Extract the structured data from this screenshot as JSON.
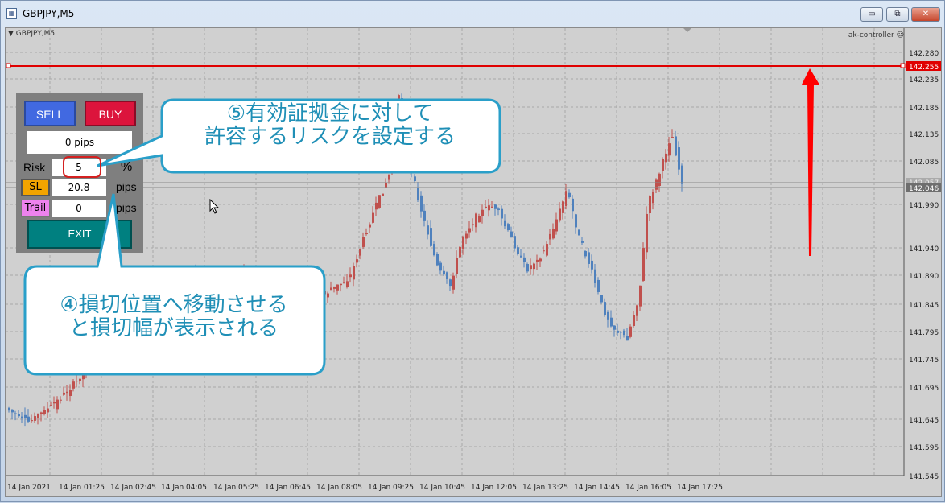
{
  "window": {
    "title": "GBPJPY,M5",
    "minimize_glyph": "▭",
    "restore_glyph": "⧉",
    "close_glyph": "✕"
  },
  "chart": {
    "symbol_label": "▼ GBPJPY,M5",
    "indicator_label": "ak-controller ☺",
    "colors": {
      "up": "#c0504d",
      "down": "#4f81bd",
      "grid": "#a8a8a8",
      "background": "#d0d0d0",
      "line": "#e00000"
    },
    "price_scale": [
      "142.280",
      "142.235",
      "142.185",
      "142.135",
      "142.085",
      "141.990",
      "141.940",
      "141.890",
      "141.845",
      "141.795",
      "141.745",
      "141.695",
      "141.645",
      "141.595",
      "141.545"
    ],
    "current_price": "142.046",
    "current_price_overlapped": "142.057",
    "line_price": "142.255",
    "time_labels": [
      "14 Jan 2021",
      "14 Jan 01:25",
      "14 Jan 02:45",
      "14 Jan 04:05",
      "14 Jan 05:25",
      "14 Jan 06:45",
      "14 Jan 08:05",
      "14 Jan 09:25",
      "14 Jan 10:45",
      "14 Jan 12:05",
      "14 Jan 13:25",
      "14 Jan 14:45",
      "14 Jan 16:05",
      "14 Jan 17:25"
    ]
  },
  "panel": {
    "sell_label": "SELL",
    "buy_label": "BUY",
    "pips_display": "0 pips",
    "risk_label": "Risk",
    "risk_value": "5",
    "risk_unit": "%",
    "sl_label": "SL",
    "sl_value": "20.8",
    "sl_unit": "pips",
    "trail_label": "Trail",
    "trail_value": "0",
    "trail_unit": "pips",
    "exit_label": "EXIT"
  },
  "callouts": {
    "c5_line1": "⑤有効証拠金に対して",
    "c5_line2": "許容するリスクを設定する",
    "c4_line1": "④損切位置へ移動させる",
    "c4_line2": "と損切幅が表示される"
  }
}
